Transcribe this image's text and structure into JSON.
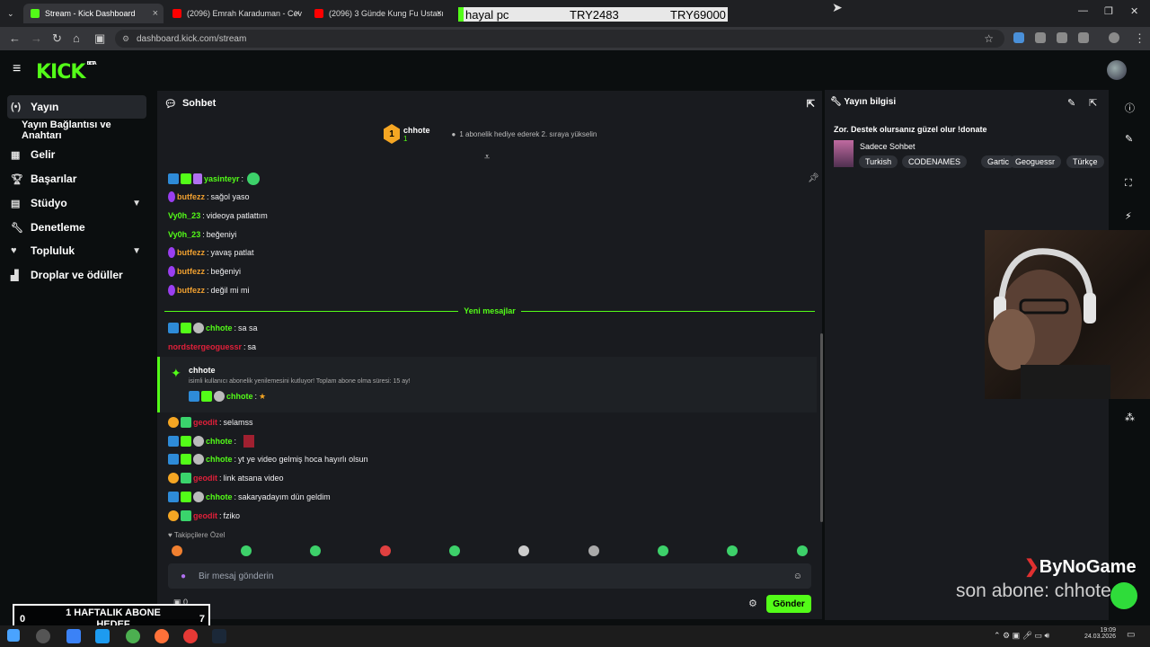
{
  "browser": {
    "tabs": [
      {
        "title": "Stream - Kick Dashboard",
        "favicon_color": "#53fc18"
      },
      {
        "title": "(2096) Emrah Karaduman - Cev",
        "favicon_color": "#ff0000"
      },
      {
        "title": "(2096) 3 Günde Kung Fu Ustası",
        "favicon_color": "#ff0000"
      }
    ],
    "overlay_bar": {
      "name": "hayal pc",
      "current": "TRY2483",
      "goal": "TRY69000"
    },
    "url": "dashboard.kick.com/stream"
  },
  "kick": {
    "logo": "KICK",
    "logo_sup": "BETA"
  },
  "sidebar": {
    "items": [
      {
        "label": "Yayın",
        "icon": "broadcast-icon"
      },
      {
        "label": "Yayın Bağlantısı ve Anahtarı",
        "icon": ""
      },
      {
        "label": "Gelir",
        "icon": "revenue-icon"
      },
      {
        "label": "Başarılar",
        "icon": "trophy-icon"
      },
      {
        "label": "Stüdyo",
        "icon": "studio-icon"
      },
      {
        "label": "Denetleme",
        "icon": "wrench-icon"
      },
      {
        "label": "Topluluk",
        "icon": "community-icon"
      },
      {
        "label": "Droplar ve ödüller",
        "icon": "drops-icon"
      }
    ]
  },
  "chat": {
    "title": "Sohbet",
    "pinned_user": "chhote",
    "pinned_rank": "1",
    "pinned_count": "1",
    "gift_hint": "1 abonelik hediye ederek 2. sıraya yükselin",
    "new_messages_label": "Yeni mesajlar",
    "messages_before": [
      {
        "user": "yasinteyr",
        "text": "",
        "color": "green"
      },
      {
        "user": "butfezz",
        "text": "sağol yaso",
        "color": "orange"
      },
      {
        "user": "Vy0h_23",
        "text": "videoya patlattım",
        "color": "green"
      },
      {
        "user": "Vy0h_23",
        "text": "beğeniyi",
        "color": "green"
      },
      {
        "user": "butfezz",
        "text": "yavaş patlat",
        "color": "orange"
      },
      {
        "user": "butfezz",
        "text": "beğeniyi",
        "color": "orange"
      },
      {
        "user": "butfezz",
        "text": "değil mi mi",
        "color": "orange"
      }
    ],
    "messages_after_a": [
      {
        "user": "chhote",
        "text": "sa sa",
        "color": "green"
      },
      {
        "user": "nordstergeoguessr",
        "text": "sa",
        "color": "red"
      }
    ],
    "sub_notice": {
      "user": "chhote",
      "text": "isimli kullanıcı abonelik yenilemesini kutluyor! Toplam abone olma süresi: 15 ay!",
      "reply_user": "chhote"
    },
    "messages_after_b": [
      {
        "user": "geodit",
        "text": "selamss",
        "color": "red"
      },
      {
        "user": "chhote",
        "text": "",
        "color": "green"
      },
      {
        "user": "chhote",
        "text": "yt ye video gelmiş hoca hayırlı olsun",
        "color": "green"
      },
      {
        "user": "geodit",
        "text": "link atsana video",
        "color": "red"
      },
      {
        "user": "chhote",
        "text": "sakaryadayım dün geldim",
        "color": "green"
      },
      {
        "user": "geodit",
        "text": "fziko",
        "color": "red"
      }
    ],
    "emote_section": "Takipçilere Özel",
    "input_placeholder": "Bir mesaj gönderin",
    "points": "0",
    "send_label": "Gönder"
  },
  "info": {
    "title": "Yayın bilgisi",
    "stream_title": "Zor. Destek olursanız güzel olur !donate",
    "category": "Sadece Sohbet",
    "tags": [
      "Turkish",
      "CODENAMES",
      "Gartic",
      "Geoguessr",
      "Türkçe"
    ]
  },
  "overlays": {
    "weekly_label": "1 HAFTALIK ABONE HEDEF",
    "weekly_current": "0",
    "weekly_goal": "7",
    "brand": "ByNoGame",
    "last_sub": "son abone: chhote"
  },
  "taskbar": {
    "time": "19:09",
    "date": "24.03.2026"
  },
  "colors": {
    "accent": "#53fc18",
    "panel": "#191b1f",
    "background": "#0b0e0f"
  }
}
